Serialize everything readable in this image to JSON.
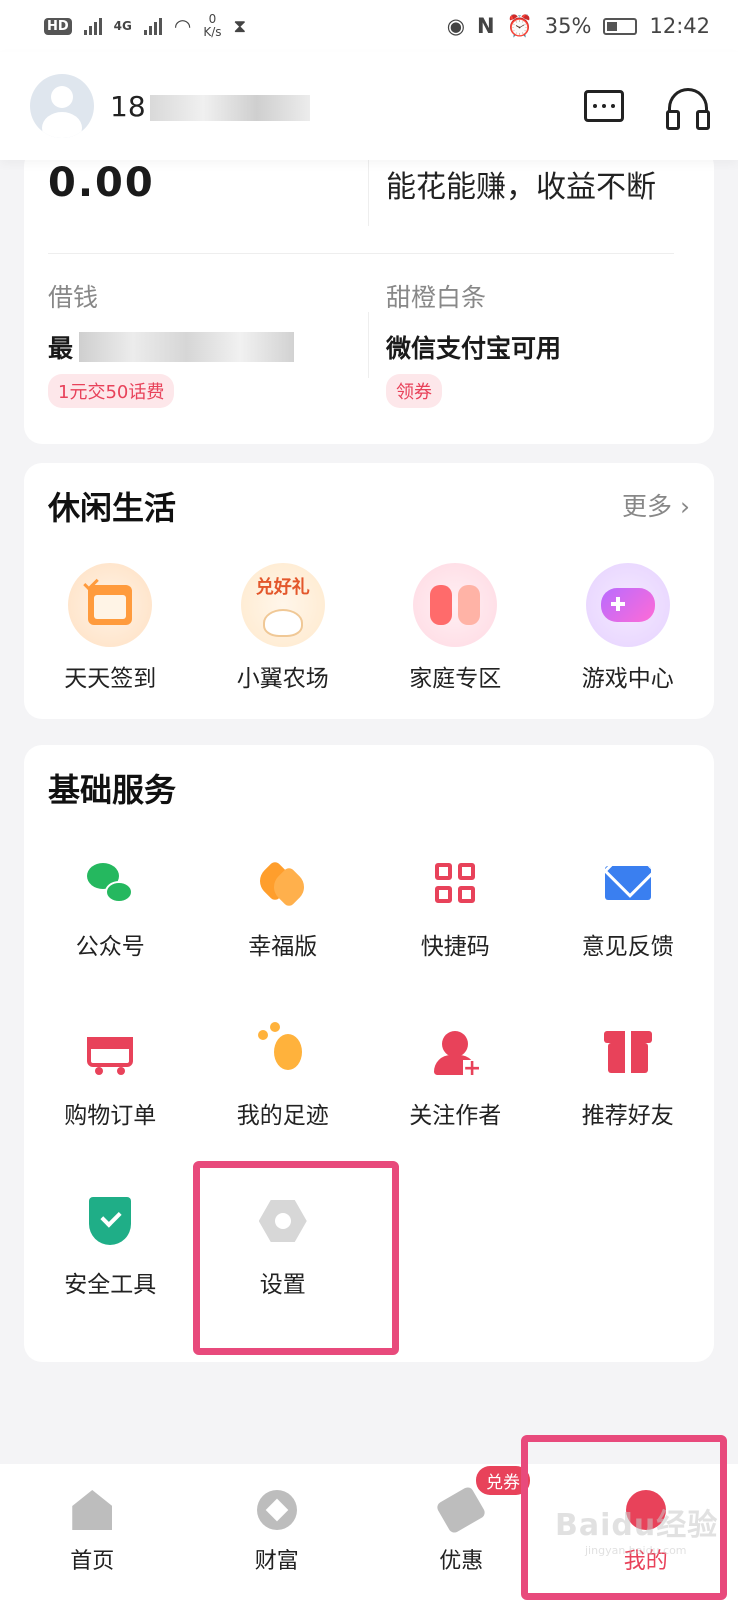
{
  "status_bar": {
    "hd": "HD",
    "net_type": "4G",
    "speed_value": "0",
    "speed_unit": "K/s",
    "battery_pct": "35%",
    "time": "12:42"
  },
  "header": {
    "username_visible": "18"
  },
  "finance": {
    "balance": "0.00",
    "slogan": "能花能赚，收益不断",
    "borrow": {
      "label": "借钱",
      "value_prefix": "最",
      "tag": "1元交50话费"
    },
    "credit": {
      "label": "甜橙白条",
      "value": "微信支付宝可用",
      "tag": "领券"
    }
  },
  "leisure": {
    "title": "休闲生活",
    "more": "更多 ›",
    "items": [
      {
        "label": "天天签到",
        "icon": "calendar-check-icon"
      },
      {
        "label": "小翼农场",
        "icon": "farm-gift-icon",
        "badge_text": "兑好礼"
      },
      {
        "label": "家庭专区",
        "icon": "family-icon"
      },
      {
        "label": "游戏中心",
        "icon": "gamepad-icon"
      }
    ]
  },
  "basic": {
    "title": "基础服务",
    "items": [
      {
        "label": "公众号",
        "icon": "wechat-icon"
      },
      {
        "label": "幸福版",
        "icon": "hearts-icon"
      },
      {
        "label": "快捷码",
        "icon": "qr-code-icon"
      },
      {
        "label": "意见反馈",
        "icon": "mail-icon"
      },
      {
        "label": "购物订单",
        "icon": "cart-icon"
      },
      {
        "label": "我的足迹",
        "icon": "footprint-icon"
      },
      {
        "label": "关注作者",
        "icon": "add-person-icon"
      },
      {
        "label": "推荐好友",
        "icon": "gift-icon"
      },
      {
        "label": "安全工具",
        "icon": "shield-check-icon"
      },
      {
        "label": "设置",
        "icon": "settings-nut-icon"
      }
    ]
  },
  "tabbar": {
    "items": [
      {
        "label": "首页",
        "icon": "home-icon"
      },
      {
        "label": "财富",
        "icon": "wealth-icon"
      },
      {
        "label": "优惠",
        "icon": "coupon-icon",
        "badge": "兑券"
      },
      {
        "label": "我的",
        "icon": "me-icon",
        "active": true
      }
    ]
  },
  "watermark": {
    "brand": "Baidu经验",
    "url": "jingyan.baidu.com"
  },
  "colors": {
    "accent": "#e8425a",
    "highlight": "#e84a7c",
    "green": "#1fae87",
    "orange": "#ff9e2c",
    "blue": "#3a7ff0"
  }
}
